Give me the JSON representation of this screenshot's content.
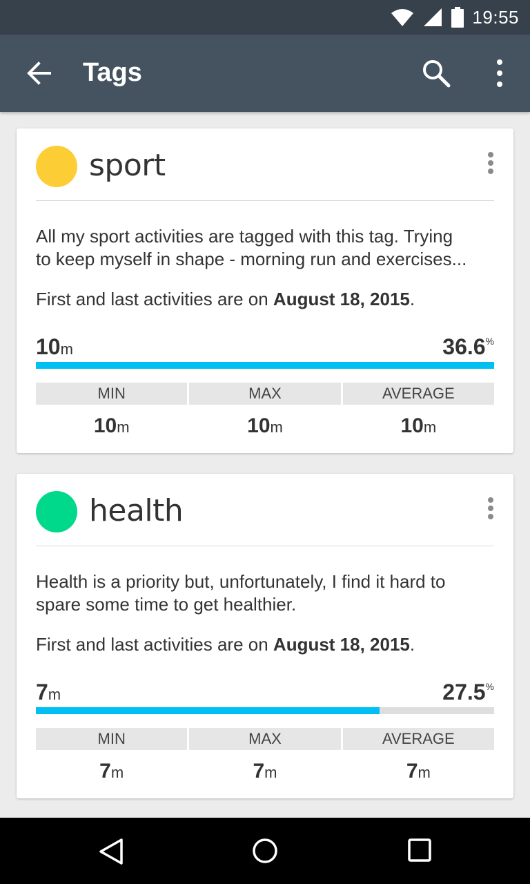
{
  "status_bar": {
    "time": "19:55",
    "icons": [
      "wifi-icon",
      "signal-icon",
      "battery-icon"
    ]
  },
  "app_bar": {
    "title": "Tags",
    "back_icon": "arrow-left-icon",
    "search_icon": "search-icon",
    "more_icon": "more-vert-icon"
  },
  "tags": [
    {
      "name": "sport",
      "color": "#fdcd35",
      "description_lines": [
        "All my sport activities are tagged with this tag. Trying",
        "to keep myself in shape - morning run and exercises..."
      ],
      "dates_prefix": "First and last activities are on ",
      "dates_value": "August 18, 2015",
      "dates_suffix": ".",
      "duration_value": "10",
      "duration_unit": "m",
      "percent_value": "36.6",
      "percent_sign": "%",
      "progress_fraction": 1.0,
      "stats_headers": [
        "MIN",
        "MAX",
        "AVERAGE"
      ],
      "stats": [
        {
          "value": "10",
          "unit": "m"
        },
        {
          "value": "10",
          "unit": "m"
        },
        {
          "value": "10",
          "unit": "m"
        }
      ]
    },
    {
      "name": "health",
      "color": "#00d98b",
      "description_lines": [
        "Health is a priority but, unfortunately, I find it hard to",
        "spare some time to get healthier."
      ],
      "dates_prefix": "First and last activities are on ",
      "dates_value": "August 18, 2015",
      "dates_suffix": ".",
      "duration_value": "7",
      "duration_unit": "m",
      "percent_value": "27.5",
      "percent_sign": "%",
      "progress_fraction": 0.75,
      "stats_headers": [
        "MIN",
        "MAX",
        "AVERAGE"
      ],
      "stats": [
        {
          "value": "7",
          "unit": "m"
        },
        {
          "value": "7",
          "unit": "m"
        },
        {
          "value": "7",
          "unit": "m"
        }
      ]
    }
  ],
  "nav_bar": {
    "icons": [
      "nav-back-icon",
      "nav-home-icon",
      "nav-recents-icon"
    ]
  },
  "colors": {
    "status_bar": "#37414b",
    "app_bar": "#455260",
    "progress": "#00bff3",
    "background": "#ececec"
  }
}
